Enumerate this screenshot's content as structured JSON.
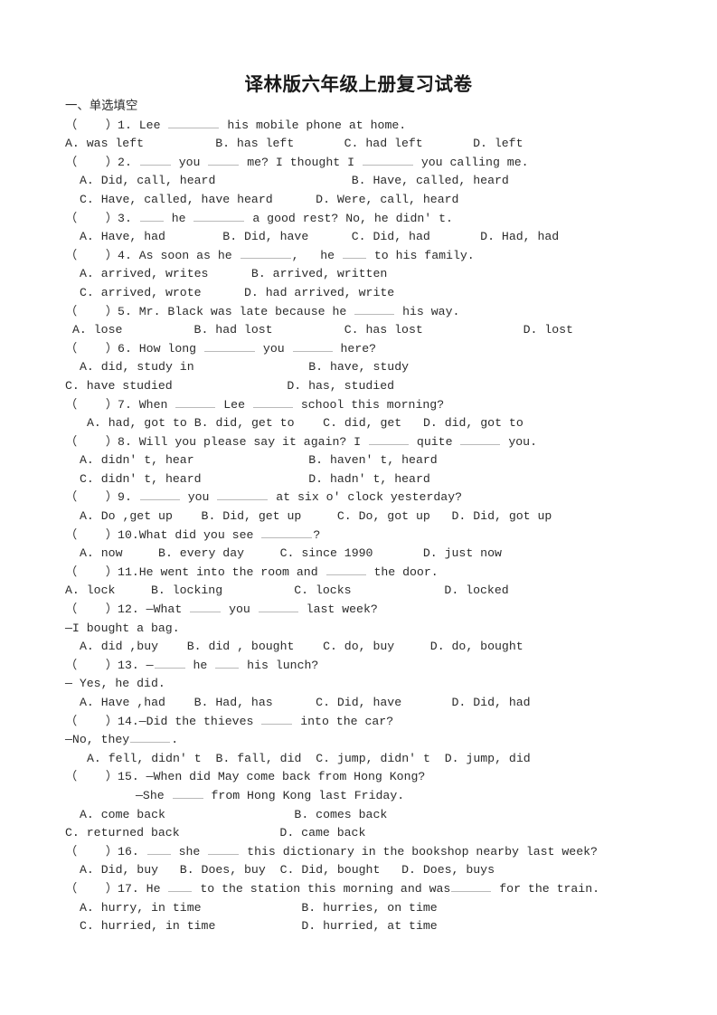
{
  "document": {
    "title": "译林版六年级上册复习试卷",
    "section_heading": "一、单选填空",
    "paper_size": "793x1122",
    "text_color": "#2b2b2b"
  },
  "lines": [
    {
      "id": "l01",
      "indent": 0,
      "script": "cn",
      "text": "一、单选填空"
    },
    {
      "id": "l02",
      "indent": 0,
      "script": "en",
      "text": "（    ）1. Lee ________ his mobile phone at home."
    },
    {
      "id": "l03",
      "indent": 0,
      "script": "en",
      "text": "A. was left          B. has left       C. had left       D. left"
    },
    {
      "id": "l04",
      "indent": 0,
      "script": "en",
      "text": "（    ）2. _____ you _____ me? I thought I ________ you calling me."
    },
    {
      "id": "l05",
      "indent": 2,
      "script": "en",
      "text": "A. Did, call, heard                   B. Have, called, heard"
    },
    {
      "id": "l06",
      "indent": 2,
      "script": "en",
      "text": "C. Have, called, have heard      D. Were, call, heard"
    },
    {
      "id": "l07",
      "indent": 0,
      "script": "en",
      "text": "（    ）3. ____ he ________ a good rest? No, he didn' t."
    },
    {
      "id": "l08",
      "indent": 2,
      "script": "en",
      "text": "A. Have, had        B. Did, have      C. Did, had       D. Had, had"
    },
    {
      "id": "l09",
      "indent": 0,
      "script": "en",
      "text": "（    ）4. As soon as he ________,   he ____ to his family."
    },
    {
      "id": "l10",
      "indent": 2,
      "script": "en",
      "text": "A. arrived, writes      B. arrived, written"
    },
    {
      "id": "l11",
      "indent": 2,
      "script": "en",
      "text": "C. arrived, wrote      D. had arrived, write"
    },
    {
      "id": "l12",
      "indent": 0,
      "script": "en",
      "text": "（    ）5. Mr. Black was late because he ______ his way."
    },
    {
      "id": "l13",
      "indent": 1,
      "script": "en",
      "text": "A. lose          B. had lost          C. has lost              D. lost"
    },
    {
      "id": "l14",
      "indent": 0,
      "script": "en",
      "text": "（    ）6. How long _________ you ______ here?"
    },
    {
      "id": "l15",
      "indent": 2,
      "script": "en",
      "text": "A. did, study in                B. have, study"
    },
    {
      "id": "l16",
      "indent": 0,
      "script": "en",
      "text": "C. have studied                D. has, studied"
    },
    {
      "id": "l17",
      "indent": 0,
      "script": "en",
      "text": "（    ）7. When _______ Lee _______ school this morning?"
    },
    {
      "id": "l18",
      "indent": 3,
      "script": "en",
      "text": "A. had, got to B. did, get to    C. did, get   D. did, got to"
    },
    {
      "id": "l19",
      "indent": 0,
      "script": "en",
      "text": "（    ）8. Will you please say it again? I _______ quite ______ you."
    },
    {
      "id": "l20",
      "indent": 2,
      "script": "en",
      "text": "A. didn' t, hear                B. haven' t, heard"
    },
    {
      "id": "l21",
      "indent": 2,
      "script": "en",
      "text": "C. didn' t, heard               D. hadn' t, heard"
    },
    {
      "id": "l22",
      "indent": 0,
      "script": "en",
      "text": "（    ）9. ______ you ________ at six o' clock yesterday?"
    },
    {
      "id": "l23",
      "indent": 2,
      "script": "en",
      "text": "A. Do ,get up    B. Did, get up     C. Do, got up   D. Did, got up"
    },
    {
      "id": "l24",
      "indent": 0,
      "script": "en",
      "text": "（    ）10.What did you see _________?"
    },
    {
      "id": "l25",
      "indent": 2,
      "script": "en",
      "text": "A. now     B. every day     C. since 1990       D. just now"
    },
    {
      "id": "l26",
      "indent": 0,
      "script": "en",
      "text": "（    ）11.He went into the room and _______ the door."
    },
    {
      "id": "l27",
      "indent": 0,
      "script": "en",
      "text": "A. lock     B. locking          C. locks             D. locked"
    },
    {
      "id": "l28",
      "indent": 0,
      "script": "en",
      "text": "（    ）12. —What _____ you _______ last week?"
    },
    {
      "id": "l29",
      "indent": 0,
      "script": "en",
      "text": "—I bought a bag."
    },
    {
      "id": "l30",
      "indent": 2,
      "script": "en",
      "text": "A. did ,buy    B. did , bought    C. do, buy     D. do, bought"
    },
    {
      "id": "l31",
      "indent": 0,
      "script": "en",
      "text": "（    ）13. —_____ he ____ his lunch?"
    },
    {
      "id": "l32",
      "indent": 0,
      "script": "en",
      "text": "— Yes, he did."
    },
    {
      "id": "l33",
      "indent": 2,
      "script": "en",
      "text": "A. Have ,had    B. Had, has      C. Did, have       D. Did, had"
    },
    {
      "id": "l34",
      "indent": 0,
      "script": "en",
      "text": "（    ）14.—Did the thieves _____ into the car?"
    },
    {
      "id": "l35",
      "indent": 0,
      "script": "en",
      "text": "—No, they______."
    },
    {
      "id": "l36",
      "indent": 3,
      "script": "en",
      "text": "A. fell, didn' t  B. fall, did  C. jump, didn' t  D. jump, did"
    },
    {
      "id": "l37",
      "indent": 0,
      "script": "en",
      "text": "（    ）15. —When did May come back from Hong Kong?"
    },
    {
      "id": "l38",
      "indent": 7,
      "script": "en",
      "text": "—She _____ from Hong Kong last Friday."
    },
    {
      "id": "l39",
      "indent": 2,
      "script": "en",
      "text": "A. come back                  B. comes back"
    },
    {
      "id": "l40",
      "indent": 0,
      "script": "en",
      "text": "C. returned back              D. came back"
    },
    {
      "id": "l41",
      "indent": 0,
      "script": "en",
      "text": "（    ）16. ____ she _____ this dictionary in the bookshop nearby last week?"
    },
    {
      "id": "l42",
      "indent": 2,
      "script": "en",
      "text": "A. Did, buy   B. Does, buy  C. Did, bought   D. Does, buys"
    },
    {
      "id": "l43",
      "indent": 0,
      "script": "en",
      "text": "（    ）17. He ____ to the station this morning and was______ for the train."
    },
    {
      "id": "l44",
      "indent": 2,
      "script": "en",
      "text": "A. hurry, in time              B. hurries, on time"
    },
    {
      "id": "l45",
      "indent": 2,
      "script": "en",
      "text": "C. hurried, in time            D. hurried, at time"
    }
  ],
  "questions": [
    {
      "number": "1",
      "stem": "Lee ________ his mobile phone at home.",
      "options": [
        "A. was left",
        "B. has left",
        "C. had left",
        "D. left"
      ]
    },
    {
      "number": "2",
      "stem": "_____ you _____ me? I thought I ________ you calling me.",
      "options": [
        "A. Did, call, heard",
        "B. Have, called, heard",
        "C. Have, called, have heard",
        "D. Were, call, heard"
      ]
    },
    {
      "number": "3",
      "stem": "____ he ________ a good rest? No, he didn' t.",
      "options": [
        "A. Have, had",
        "B. Did, have",
        "C. Did, had",
        "D. Had, had"
      ]
    },
    {
      "number": "4",
      "stem": "As soon as he ________,   he ____ to his family.",
      "options": [
        "A. arrived, writes",
        "B. arrived, written",
        "C. arrived, wrote",
        "D. had arrived, write"
      ]
    },
    {
      "number": "5",
      "stem": "Mr. Black was late because he ______ his way.",
      "options": [
        "A. lose",
        "B. had lost",
        "C. has lost",
        "D. lost"
      ]
    },
    {
      "number": "6",
      "stem": "How long _________ you ______ here?",
      "options": [
        "A. did, study in",
        "B. have, study",
        "C. have studied",
        "D. has, studied"
      ]
    },
    {
      "number": "7",
      "stem": "When _______ Lee _______ school this morning?",
      "options": [
        "A. had, got to",
        "B. did, get to",
        "C. did, get",
        "D. did, got to"
      ]
    },
    {
      "number": "8",
      "stem": "Will you please say it again? I _______ quite ______ you.",
      "options": [
        "A. didn' t, hear",
        "B. haven' t, heard",
        "C. didn' t, heard",
        "D. hadn' t, heard"
      ]
    },
    {
      "number": "9",
      "stem": "______ you ________ at six o' clock yesterday?",
      "options": [
        "A. Do ,get up",
        "B. Did, get up",
        "C. Do, got up",
        "D. Did, got up"
      ]
    },
    {
      "number": "10",
      "stem": "What did you see _________?",
      "options": [
        "A. now",
        "B. every day",
        "C. since 1990",
        "D. just now"
      ]
    },
    {
      "number": "11",
      "stem": "He went into the room and _______ the door.",
      "options": [
        "A. lock",
        "B. locking",
        "C. locks",
        "D. locked"
      ]
    },
    {
      "number": "12",
      "stem": "—What _____ you _______ last week? —I bought a bag.",
      "options": [
        "A. did ,buy",
        "B. did , bought",
        "C. do, buy",
        "D. do, bought"
      ]
    },
    {
      "number": "13",
      "stem": "—_____ he ____ his lunch? — Yes, he did.",
      "options": [
        "A. Have ,had",
        "B. Had, has",
        "C. Did, have",
        "D. Did, had"
      ]
    },
    {
      "number": "14",
      "stem": "—Did the thieves _____ into the car? —No, they______.",
      "options": [
        "A. fell, didn' t",
        "B. fall, did",
        "C. jump, didn' t",
        "D. jump, did"
      ]
    },
    {
      "number": "15",
      "stem": "—When did May come back from Hong Kong? —She _____ from Hong Kong last Friday.",
      "options": [
        "A. come back",
        "B. comes back",
        "C. returned back",
        "D. came back"
      ]
    },
    {
      "number": "16",
      "stem": "____ she _____ this dictionary in the bookshop nearby last week?",
      "options": [
        "A. Did, buy",
        "B. Does, buy",
        "C. Did, bought",
        "D. Does, buys"
      ]
    },
    {
      "number": "17",
      "stem": "He ____ to the station this morning and was______ for the train.",
      "options": [
        "A. hurry, in time",
        "B. hurries, on time",
        "C. hurried, in time",
        "D. hurried, at time"
      ]
    }
  ]
}
